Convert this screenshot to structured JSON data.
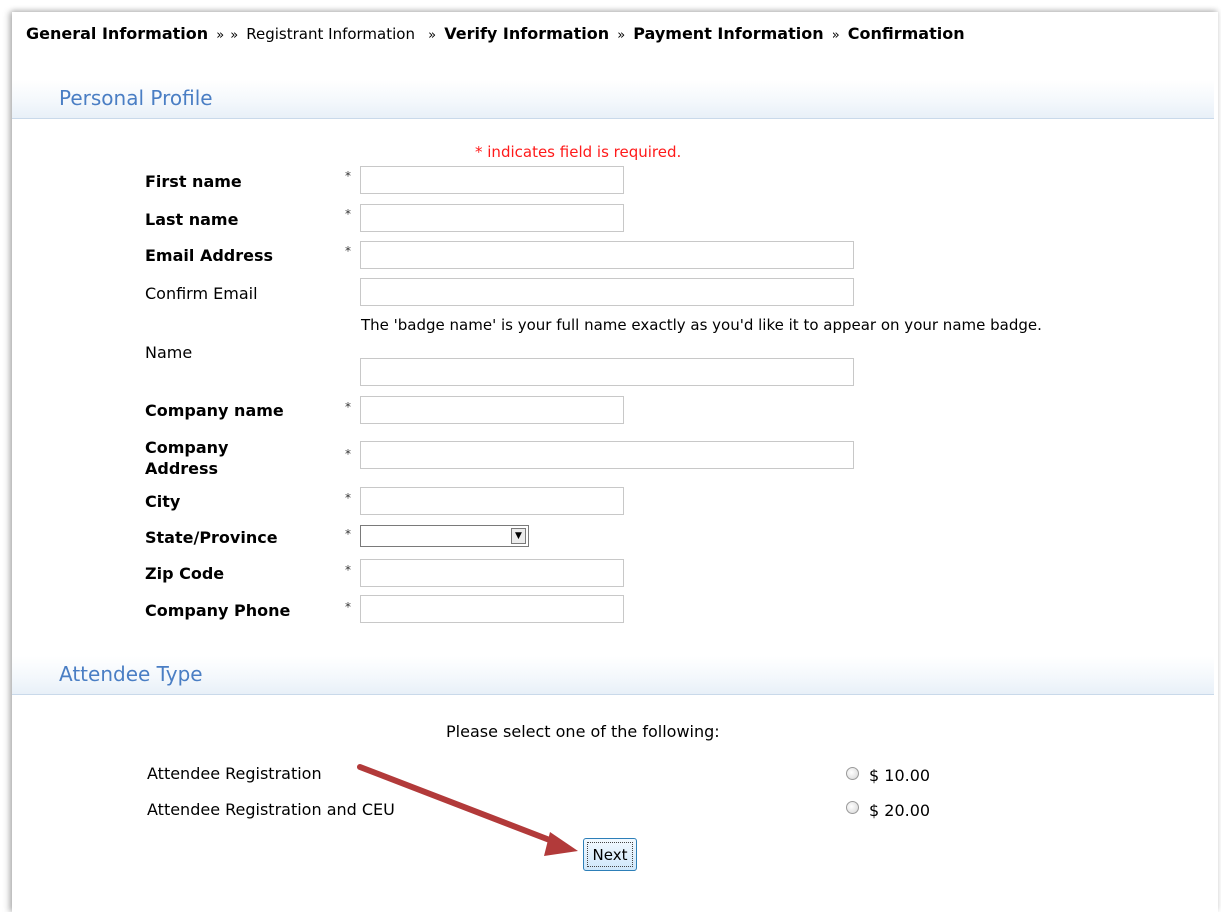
{
  "breadcrumb": {
    "step1": "General Information",
    "sep": "»",
    "step2": "Registrant Information",
    "step3": "Verify Information",
    "step4": "Payment Information",
    "step5": "Confirmation"
  },
  "profile": {
    "heading": "Personal Profile",
    "required_note": "* indicates field is required.",
    "required_marker": "*",
    "fields": {
      "first_name": {
        "label": "First name",
        "value": ""
      },
      "last_name": {
        "label": "Last name",
        "value": ""
      },
      "email": {
        "label": "Email Address",
        "value": ""
      },
      "confirm_email": {
        "label": "Confirm Email",
        "value": ""
      },
      "badge_name": {
        "label": "Name",
        "value": "",
        "help": "The 'badge name' is your full name exactly as you'd like it to appear on your name badge."
      },
      "company_name": {
        "label": "Company name",
        "value": ""
      },
      "company_address": {
        "label": "Company Address",
        "value": ""
      },
      "city": {
        "label": "City",
        "value": ""
      },
      "state": {
        "label": "State/Province",
        "value": ""
      },
      "zip": {
        "label": "Zip Code",
        "value": ""
      },
      "company_phone": {
        "label": "Company Phone",
        "value": ""
      }
    }
  },
  "attendee": {
    "heading": "Attendee Type",
    "prompt": "Please select one of the following:",
    "options": [
      {
        "label": "Attendee Registration",
        "price": "$ 10.00",
        "selected": false
      },
      {
        "label": "Attendee Registration and CEU",
        "price": "$ 20.00",
        "selected": false
      }
    ]
  },
  "actions": {
    "next_label": "Next"
  },
  "colors": {
    "heading": "#4a7ec4",
    "required": "#ff1a1a",
    "annotation_arrow": "#b23a3a"
  },
  "icons": {
    "select_dropdown": "chevron-down-icon",
    "annotation": "arrow-icon"
  }
}
